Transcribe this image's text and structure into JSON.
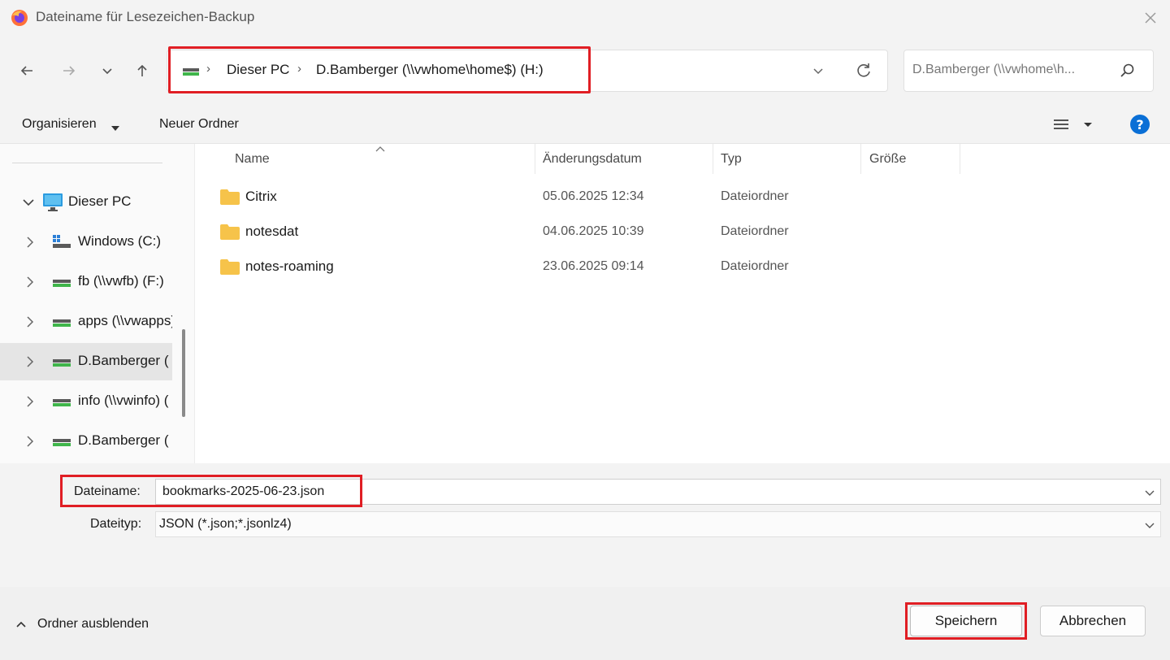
{
  "window": {
    "title": "Dateiname für Lesezeichen-Backup"
  },
  "address": {
    "crumbs": [
      "Dieser PC",
      "D.Bamberger (\\\\vwhome\\home$) (H:)"
    ]
  },
  "search": {
    "placeholder": "D.Bamberger (\\\\vwhome\\h..."
  },
  "toolbar": {
    "organize": "Organisieren",
    "new_folder": "Neuer Ordner"
  },
  "sidebar": {
    "items": [
      {
        "label": "Dieser PC"
      },
      {
        "label": "Windows (C:)"
      },
      {
        "label": "fb (\\\\vwfb) (F:)"
      },
      {
        "label": "apps (\\\\vwapps) ("
      },
      {
        "label": "D.Bamberger ("
      },
      {
        "label": "info (\\\\vwinfo) ("
      },
      {
        "label": "D.Bamberger ("
      }
    ]
  },
  "columns": {
    "name": "Name",
    "date": "Änderungsdatum",
    "type": "Typ",
    "size": "Größe"
  },
  "files": [
    {
      "name": "Citrix",
      "date": "05.06.2025 12:34",
      "type": "Dateiordner"
    },
    {
      "name": "notesdat",
      "date": "04.06.2025 10:39",
      "type": "Dateiordner"
    },
    {
      "name": "notes-roaming",
      "date": "23.06.2025 09:14",
      "type": "Dateiordner"
    }
  ],
  "form": {
    "filename_label": "Dateiname:",
    "filename_value": "bookmarks-2025-06-23.json",
    "filetype_label": "Dateityp:",
    "filetype_value": "JSON (*.json;*.jsonlz4)"
  },
  "footer": {
    "hide_folders": "Ordner ausblenden",
    "save": "Speichern",
    "cancel": "Abbrechen"
  },
  "colors": {
    "highlight": "#e01e24",
    "drive_green": "#3fb54a",
    "folder": "#f6c34a",
    "help_blue": "#0a6fd6"
  }
}
